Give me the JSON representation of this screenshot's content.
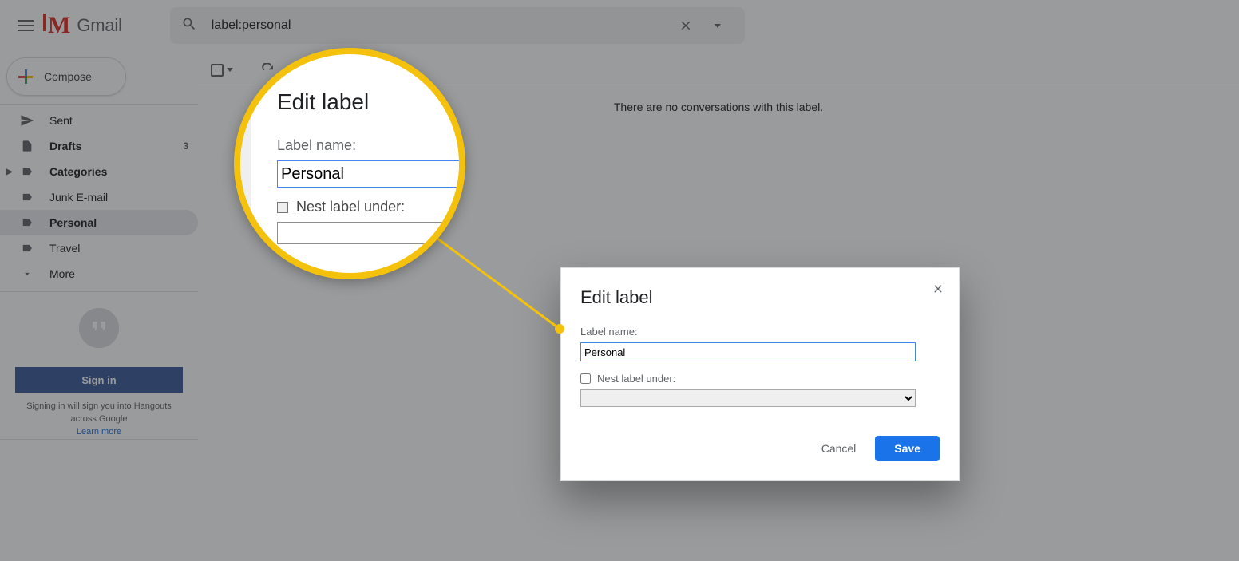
{
  "brand": "Gmail",
  "search": {
    "query": "label:personal"
  },
  "compose_label": "Compose",
  "sidebar": {
    "items": [
      {
        "label": "Sent",
        "icon": "send-icon",
        "bold": false,
        "count": ""
      },
      {
        "label": "Drafts",
        "icon": "file-icon",
        "bold": true,
        "count": "3"
      },
      {
        "label": "Categories",
        "icon": "caret-icon",
        "bold": true,
        "count": ""
      },
      {
        "label": "Junk E-mail",
        "icon": "label-icon",
        "bold": false,
        "count": ""
      },
      {
        "label": "Personal",
        "icon": "label-icon",
        "bold": true,
        "count": "",
        "active": true
      },
      {
        "label": "Travel",
        "icon": "label-icon",
        "bold": false,
        "count": ""
      },
      {
        "label": "More",
        "icon": "chevron-down-icon",
        "bold": false,
        "count": ""
      }
    ]
  },
  "hangouts": {
    "signin_label": "Sign in",
    "note_line1": "Signing in will sign you into Hangouts",
    "note_line2": "across Google",
    "learn_more": "Learn more"
  },
  "main": {
    "empty_message": "There are no conversations with this label."
  },
  "dialog": {
    "title": "Edit label",
    "field_label": "Label name:",
    "field_value": "Personal",
    "nest_label": "Nest label under:",
    "cancel_label": "Cancel",
    "save_label": "Save"
  }
}
